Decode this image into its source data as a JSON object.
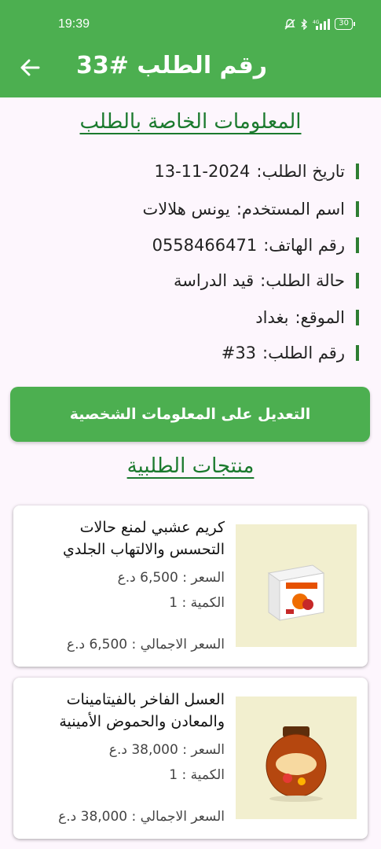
{
  "status_bar": {
    "time": "19:39",
    "battery": "30"
  },
  "app_bar": {
    "title": "رقم الطلب #33"
  },
  "order_info": {
    "heading": "المعلومات الخاصة بالطلب",
    "rows": [
      {
        "label": "تاريخ الطلب:",
        "value": "13-11-2024"
      },
      {
        "label": "اسم المستخدم:",
        "value": "يونس هلالات"
      },
      {
        "label": "رقم الهاتف:",
        "value": "0558466471"
      },
      {
        "label": "حالة الطلب:",
        "value": "قيد الدراسة"
      },
      {
        "label": "الموقع:",
        "value": "بغداد"
      },
      {
        "label": "رقم الطلب:",
        "value": "#33"
      }
    ]
  },
  "edit_button": {
    "label": "التعديل على المعلومات الشخصية"
  },
  "products": {
    "heading": "منتجات الطلبية",
    "items": [
      {
        "name": "كريم عشبي لمنع حالات التحسس والالتهاب الجلدي",
        "price": "السعر : 6,500 د.ع",
        "quantity": "الكمية : 1",
        "total": "السعر الاجمالي : 6,500 د.ع"
      },
      {
        "name": "العسل الفاخر بالفيتامينات والمعادن والحموض الأمينية",
        "price": "السعر : 38,000 د.ع",
        "quantity": "الكمية : 1",
        "total": "السعر الاجمالي : 38,000 د.ع"
      }
    ]
  }
}
